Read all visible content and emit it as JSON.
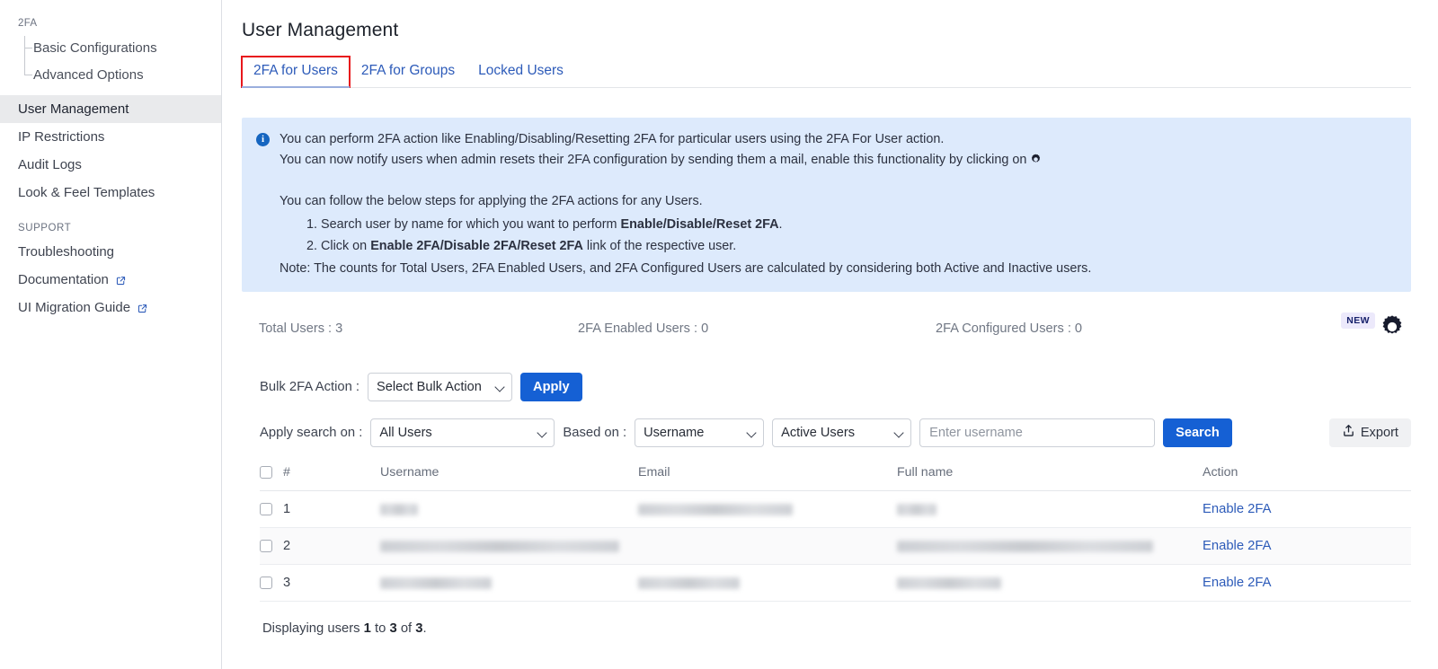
{
  "sidebar": {
    "group_label": "2FA",
    "tree_items": [
      {
        "label": "Basic Configurations",
        "name": "basic-configurations"
      },
      {
        "label": "Advanced Options",
        "name": "advanced-options"
      }
    ],
    "items": [
      {
        "label": "User Management",
        "name": "user-management",
        "active": true,
        "external": false
      },
      {
        "label": "IP Restrictions",
        "name": "ip-restrictions",
        "active": false,
        "external": false
      },
      {
        "label": "Audit Logs",
        "name": "audit-logs",
        "active": false,
        "external": false
      },
      {
        "label": "Look & Feel Templates",
        "name": "look-and-feel-templates",
        "active": false,
        "external": false
      }
    ],
    "support_label": "SUPPORT",
    "support_items": [
      {
        "label": "Troubleshooting",
        "name": "troubleshooting",
        "external": false
      },
      {
        "label": "Documentation",
        "name": "documentation",
        "external": true
      },
      {
        "label": "UI Migration Guide",
        "name": "ui-migration-guide",
        "external": true
      }
    ]
  },
  "page": {
    "title": "User Management"
  },
  "tabs": [
    {
      "label": "2FA for Users",
      "name": "tab-2fa-for-users",
      "active": true,
      "highlighted": true
    },
    {
      "label": "2FA for Groups",
      "name": "tab-2fa-for-groups",
      "active": false,
      "highlighted": false
    },
    {
      "label": "Locked Users",
      "name": "tab-locked-users",
      "active": false,
      "highlighted": false
    }
  ],
  "banner": {
    "line1": "You can perform 2FA action like Enabling/Disabling/Resetting 2FA for particular users using the 2FA For User action.",
    "line2_prefix": "You can now notify users when admin resets their 2FA configuration by sending them a mail, enable this functionality by clicking on",
    "line3": "You can follow the below steps for applying the 2FA actions for any Users.",
    "step1_prefix": "Search user by name for which you want to perform ",
    "step1_bold": "Enable/Disable/Reset 2FA",
    "step1_suffix": ".",
    "step2_prefix": "Click on ",
    "step2_bold": "Enable 2FA/Disable 2FA/Reset 2FA",
    "step2_suffix": " link of the respective user.",
    "note": "Note: The counts for Total Users, 2FA Enabled Users, and 2FA Configured Users are calculated by considering both Active and Inactive users."
  },
  "stats": {
    "total_users": "Total Users : 3",
    "enabled_users": "2FA Enabled Users : 0",
    "configured_users": "2FA Configured Users : 0",
    "new_badge": "NEW"
  },
  "bulk": {
    "label": "Bulk 2FA Action :",
    "select_value": "Select Bulk Action",
    "apply_label": "Apply"
  },
  "search": {
    "apply_label": "Apply search on :",
    "scope_value": "All Users",
    "based_label": "Based on :",
    "based_value": "Username",
    "status_value": "Active Users",
    "placeholder": "Enter username",
    "input_value": "",
    "search_label": "Search",
    "export_label": "Export"
  },
  "table": {
    "headers": [
      "#",
      "Username",
      "Email",
      "Full name",
      "Action"
    ],
    "rows": [
      {
        "num": "1",
        "username": "",
        "email": "",
        "fullname": "",
        "action": "Enable 2FA",
        "w_user": 42,
        "w_mail": 172,
        "w_full": 44
      },
      {
        "num": "2",
        "username": "",
        "email": "",
        "fullname": "",
        "action": "Enable 2FA",
        "w_user": 266,
        "w_mail": 0,
        "w_full": 285
      },
      {
        "num": "3",
        "username": "",
        "email": "",
        "fullname": "",
        "action": "Enable 2FA",
        "w_user": 124,
        "w_mail": 113,
        "w_full": 116
      }
    ]
  },
  "footer": {
    "prefix": "Displaying users ",
    "from": "1",
    "mid1": " to ",
    "to": "3",
    "mid2": " of ",
    "total": "3",
    "suffix": "."
  },
  "colors": {
    "accent": "#1560d4",
    "link": "#2d5bb9",
    "banner_bg": "#ddeafc",
    "highlight": "#e8171c",
    "badge_bg": "#ece9fb",
    "badge_text": "#17216b"
  }
}
